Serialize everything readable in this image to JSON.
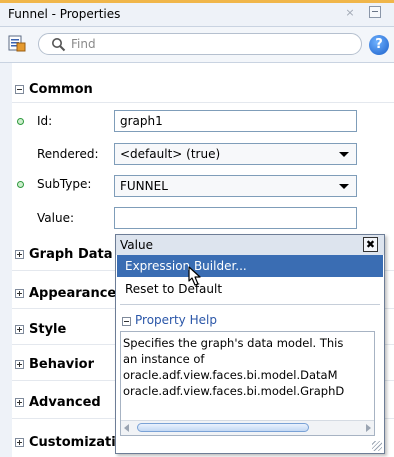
{
  "panel": {
    "title": "Funnel - Properties",
    "close_glyph": "×"
  },
  "toolbar": {
    "search_placeholder": "Find",
    "help_glyph": "?",
    "properties_icon": "properties-sheet-icon",
    "search_icon": "magnifier-icon"
  },
  "sections": {
    "common": "Common",
    "graph_data": "Graph Data",
    "appearance": "Appearance",
    "style": "Style",
    "behavior": "Behavior",
    "advanced": "Advanced",
    "customization": "Customization"
  },
  "properties": {
    "id": {
      "label": "Id:",
      "value": "graph1"
    },
    "rendered": {
      "label": "Rendered:",
      "value": "<default> (true)"
    },
    "subtype": {
      "label": "SubType:",
      "value": "FUNNEL"
    },
    "value": {
      "label": "Value:",
      "value": ""
    }
  },
  "popup": {
    "title": "Value",
    "close_glyph": "✖",
    "menu": [
      {
        "label": "Expression Builder...",
        "selected": true
      },
      {
        "label": "Reset to Default",
        "selected": false
      }
    ],
    "property_help": {
      "title": "Property Help",
      "text": "Specifies the graph's data model. This\nan instance of\noracle.adf.view.faces.bi.model.DataM\noracle.adf.view.faces.bi.model.GraphD"
    }
  },
  "colors": {
    "accent": "#f0b64a",
    "selection": "#3a6db3",
    "help_link": "#2a56a8",
    "required_dot": "#2f9a3f"
  }
}
